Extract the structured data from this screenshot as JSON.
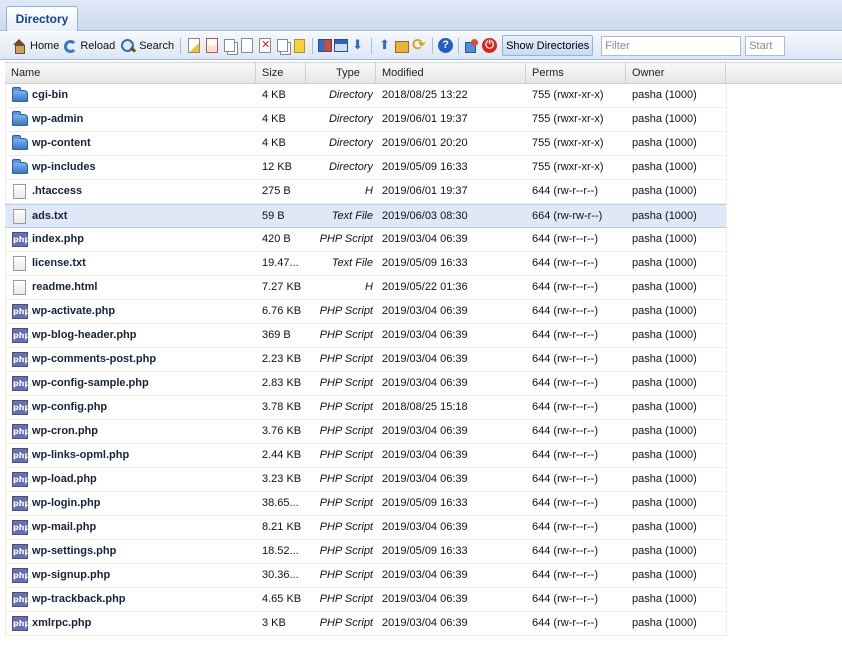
{
  "tab": {
    "label": "Directory"
  },
  "toolbar": {
    "home_label": "Home",
    "reload_label": "Reload",
    "search_label": "Search",
    "show_dirs_label": "Show Directories",
    "filter_placeholder": "Filter",
    "start_placeholder": "Start"
  },
  "columns": {
    "name": "Name",
    "size": "Size",
    "type": "Type",
    "modified": "Modified",
    "perms": "Perms",
    "owner": "Owner"
  },
  "files": [
    {
      "name": "cgi-bin",
      "size": "4 KB",
      "type": "Directory",
      "modified": "2018/08/25 13:22",
      "perms": "755 (rwxr-xr-x)",
      "owner": "pasha (1000)",
      "icon": "folder"
    },
    {
      "name": "wp-admin",
      "size": "4 KB",
      "type": "Directory",
      "modified": "2019/06/01 19:37",
      "perms": "755 (rwxr-xr-x)",
      "owner": "pasha (1000)",
      "icon": "folder"
    },
    {
      "name": "wp-content",
      "size": "4 KB",
      "type": "Directory",
      "modified": "2019/06/01 20:20",
      "perms": "755 (rwxr-xr-x)",
      "owner": "pasha (1000)",
      "icon": "folder"
    },
    {
      "name": "wp-includes",
      "size": "12 KB",
      "type": "Directory",
      "modified": "2019/05/09 16:33",
      "perms": "755 (rwxr-xr-x)",
      "owner": "pasha (1000)",
      "icon": "folder"
    },
    {
      "name": ".htaccess",
      "size": "275 B",
      "type": "H",
      "modified": "2019/06/01 19:37",
      "perms": "644 (rw-r--r--)",
      "owner": "pasha (1000)",
      "icon": "file"
    },
    {
      "name": "ads.txt",
      "size": "59 B",
      "type": "Text File",
      "modified": "2019/06/03 08:30",
      "perms": "664 (rw-rw-r--)",
      "owner": "pasha (1000)",
      "icon": "file",
      "selected": true
    },
    {
      "name": "index.php",
      "size": "420 B",
      "type": "PHP Script",
      "modified": "2019/03/04 06:39",
      "perms": "644 (rw-r--r--)",
      "owner": "pasha (1000)",
      "icon": "php"
    },
    {
      "name": "license.txt",
      "size": "19.47...",
      "type": "Text File",
      "modified": "2019/05/09 16:33",
      "perms": "644 (rw-r--r--)",
      "owner": "pasha (1000)",
      "icon": "file"
    },
    {
      "name": "readme.html",
      "size": "7.27 KB",
      "type": "H",
      "modified": "2019/05/22 01:36",
      "perms": "644 (rw-r--r--)",
      "owner": "pasha (1000)",
      "icon": "file"
    },
    {
      "name": "wp-activate.php",
      "size": "6.76 KB",
      "type": "PHP Script",
      "modified": "2019/03/04 06:39",
      "perms": "644 (rw-r--r--)",
      "owner": "pasha (1000)",
      "icon": "php"
    },
    {
      "name": "wp-blog-header.php",
      "size": "369 B",
      "type": "PHP Script",
      "modified": "2019/03/04 06:39",
      "perms": "644 (rw-r--r--)",
      "owner": "pasha (1000)",
      "icon": "php"
    },
    {
      "name": "wp-comments-post.php",
      "size": "2.23 KB",
      "type": "PHP Script",
      "modified": "2019/03/04 06:39",
      "perms": "644 (rw-r--r--)",
      "owner": "pasha (1000)",
      "icon": "php"
    },
    {
      "name": "wp-config-sample.php",
      "size": "2.83 KB",
      "type": "PHP Script",
      "modified": "2019/03/04 06:39",
      "perms": "644 (rw-r--r--)",
      "owner": "pasha (1000)",
      "icon": "php"
    },
    {
      "name": "wp-config.php",
      "size": "3.78 KB",
      "type": "PHP Script",
      "modified": "2018/08/25 15:18",
      "perms": "644 (rw-r--r--)",
      "owner": "pasha (1000)",
      "icon": "php"
    },
    {
      "name": "wp-cron.php",
      "size": "3.76 KB",
      "type": "PHP Script",
      "modified": "2019/03/04 06:39",
      "perms": "644 (rw-r--r--)",
      "owner": "pasha (1000)",
      "icon": "php"
    },
    {
      "name": "wp-links-opml.php",
      "size": "2.44 KB",
      "type": "PHP Script",
      "modified": "2019/03/04 06:39",
      "perms": "644 (rw-r--r--)",
      "owner": "pasha (1000)",
      "icon": "php"
    },
    {
      "name": "wp-load.php",
      "size": "3.23 KB",
      "type": "PHP Script",
      "modified": "2019/03/04 06:39",
      "perms": "644 (rw-r--r--)",
      "owner": "pasha (1000)",
      "icon": "php"
    },
    {
      "name": "wp-login.php",
      "size": "38.65...",
      "type": "PHP Script",
      "modified": "2019/05/09 16:33",
      "perms": "644 (rw-r--r--)",
      "owner": "pasha (1000)",
      "icon": "php"
    },
    {
      "name": "wp-mail.php",
      "size": "8.21 KB",
      "type": "PHP Script",
      "modified": "2019/03/04 06:39",
      "perms": "644 (rw-r--r--)",
      "owner": "pasha (1000)",
      "icon": "php"
    },
    {
      "name": "wp-settings.php",
      "size": "18.52...",
      "type": "PHP Script",
      "modified": "2019/05/09 16:33",
      "perms": "644 (rw-r--r--)",
      "owner": "pasha (1000)",
      "icon": "php"
    },
    {
      "name": "wp-signup.php",
      "size": "30.36...",
      "type": "PHP Script",
      "modified": "2019/03/04 06:39",
      "perms": "644 (rw-r--r--)",
      "owner": "pasha (1000)",
      "icon": "php"
    },
    {
      "name": "wp-trackback.php",
      "size": "4.65 KB",
      "type": "PHP Script",
      "modified": "2019/03/04 06:39",
      "perms": "644 (rw-r--r--)",
      "owner": "pasha (1000)",
      "icon": "php"
    },
    {
      "name": "xmlrpc.php",
      "size": "3 KB",
      "type": "PHP Script",
      "modified": "2019/03/04 06:39",
      "perms": "644 (rw-r--r--)",
      "owner": "pasha (1000)",
      "icon": "php"
    }
  ]
}
